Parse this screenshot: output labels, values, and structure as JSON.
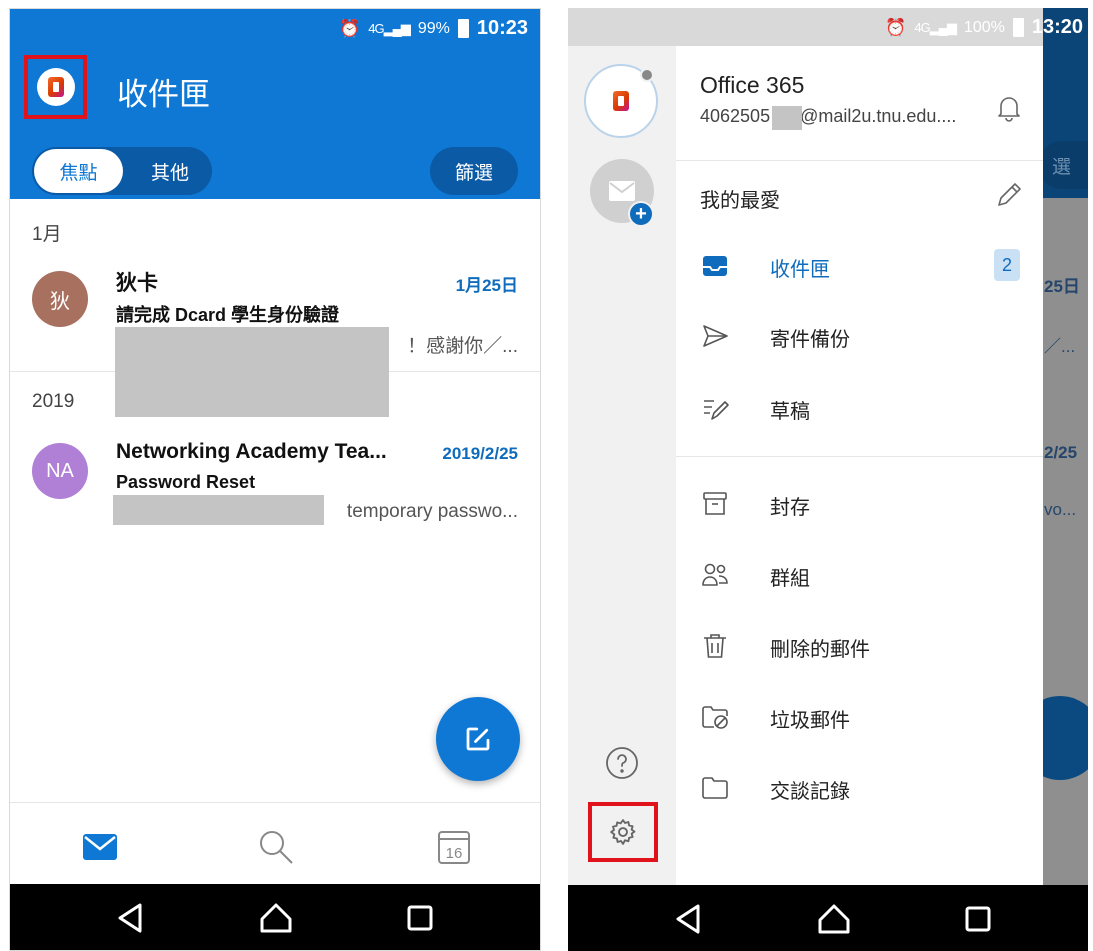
{
  "left": {
    "status": {
      "time": "10:23",
      "battery": "99%",
      "network": "4G"
    },
    "header": {
      "title": "收件匣",
      "tab_focused": "焦點",
      "tab_other": "其他",
      "filter": "篩選"
    },
    "sections": [
      "1月",
      "2019"
    ],
    "mails": [
      {
        "avatar_text": "狄",
        "avatar_color": "#a8705f",
        "sender": "狄卡",
        "date": "1月25日",
        "subject": "請完成 Dcard 學生身份驗證",
        "preview": "！感謝你／..."
      },
      {
        "avatar_text": "NA",
        "avatar_color": "#b07fd6",
        "sender": "Networking Academy Tea...",
        "date": "2019/2/25",
        "subject": "Password Reset",
        "preview": "temporary passwo..."
      }
    ],
    "bottom_nav": {
      "calendar_day": "16"
    }
  },
  "right": {
    "status": {
      "time": "13:20",
      "battery": "100%",
      "network": "4G"
    },
    "account": {
      "name": "Office 365",
      "email_prefix": "4062505",
      "email_suffix": "@mail2u.tnu.edu...."
    },
    "favorites_label": "我的最愛",
    "favorite_folders": [
      {
        "label": "收件匣",
        "icon": "inbox-icon",
        "badge": "2"
      },
      {
        "label": "寄件備份",
        "icon": "send-icon"
      },
      {
        "label": "草稿",
        "icon": "draft-icon"
      }
    ],
    "folders": [
      {
        "label": "封存",
        "icon": "archive-icon"
      },
      {
        "label": "群組",
        "icon": "groups-icon"
      },
      {
        "label": "刪除的郵件",
        "icon": "trash-icon"
      },
      {
        "label": "垃圾郵件",
        "icon": "junk-icon"
      },
      {
        "label": "交談記錄",
        "icon": "conversation-history-icon"
      }
    ],
    "background_peek": {
      "date1": "25日",
      "date2": "2/25",
      "ellipsis": "／...",
      "preview": "vo...",
      "filter": "選"
    }
  },
  "colors": {
    "brand_blue": "#0f78d4",
    "highlight_red": "#e0121c"
  }
}
